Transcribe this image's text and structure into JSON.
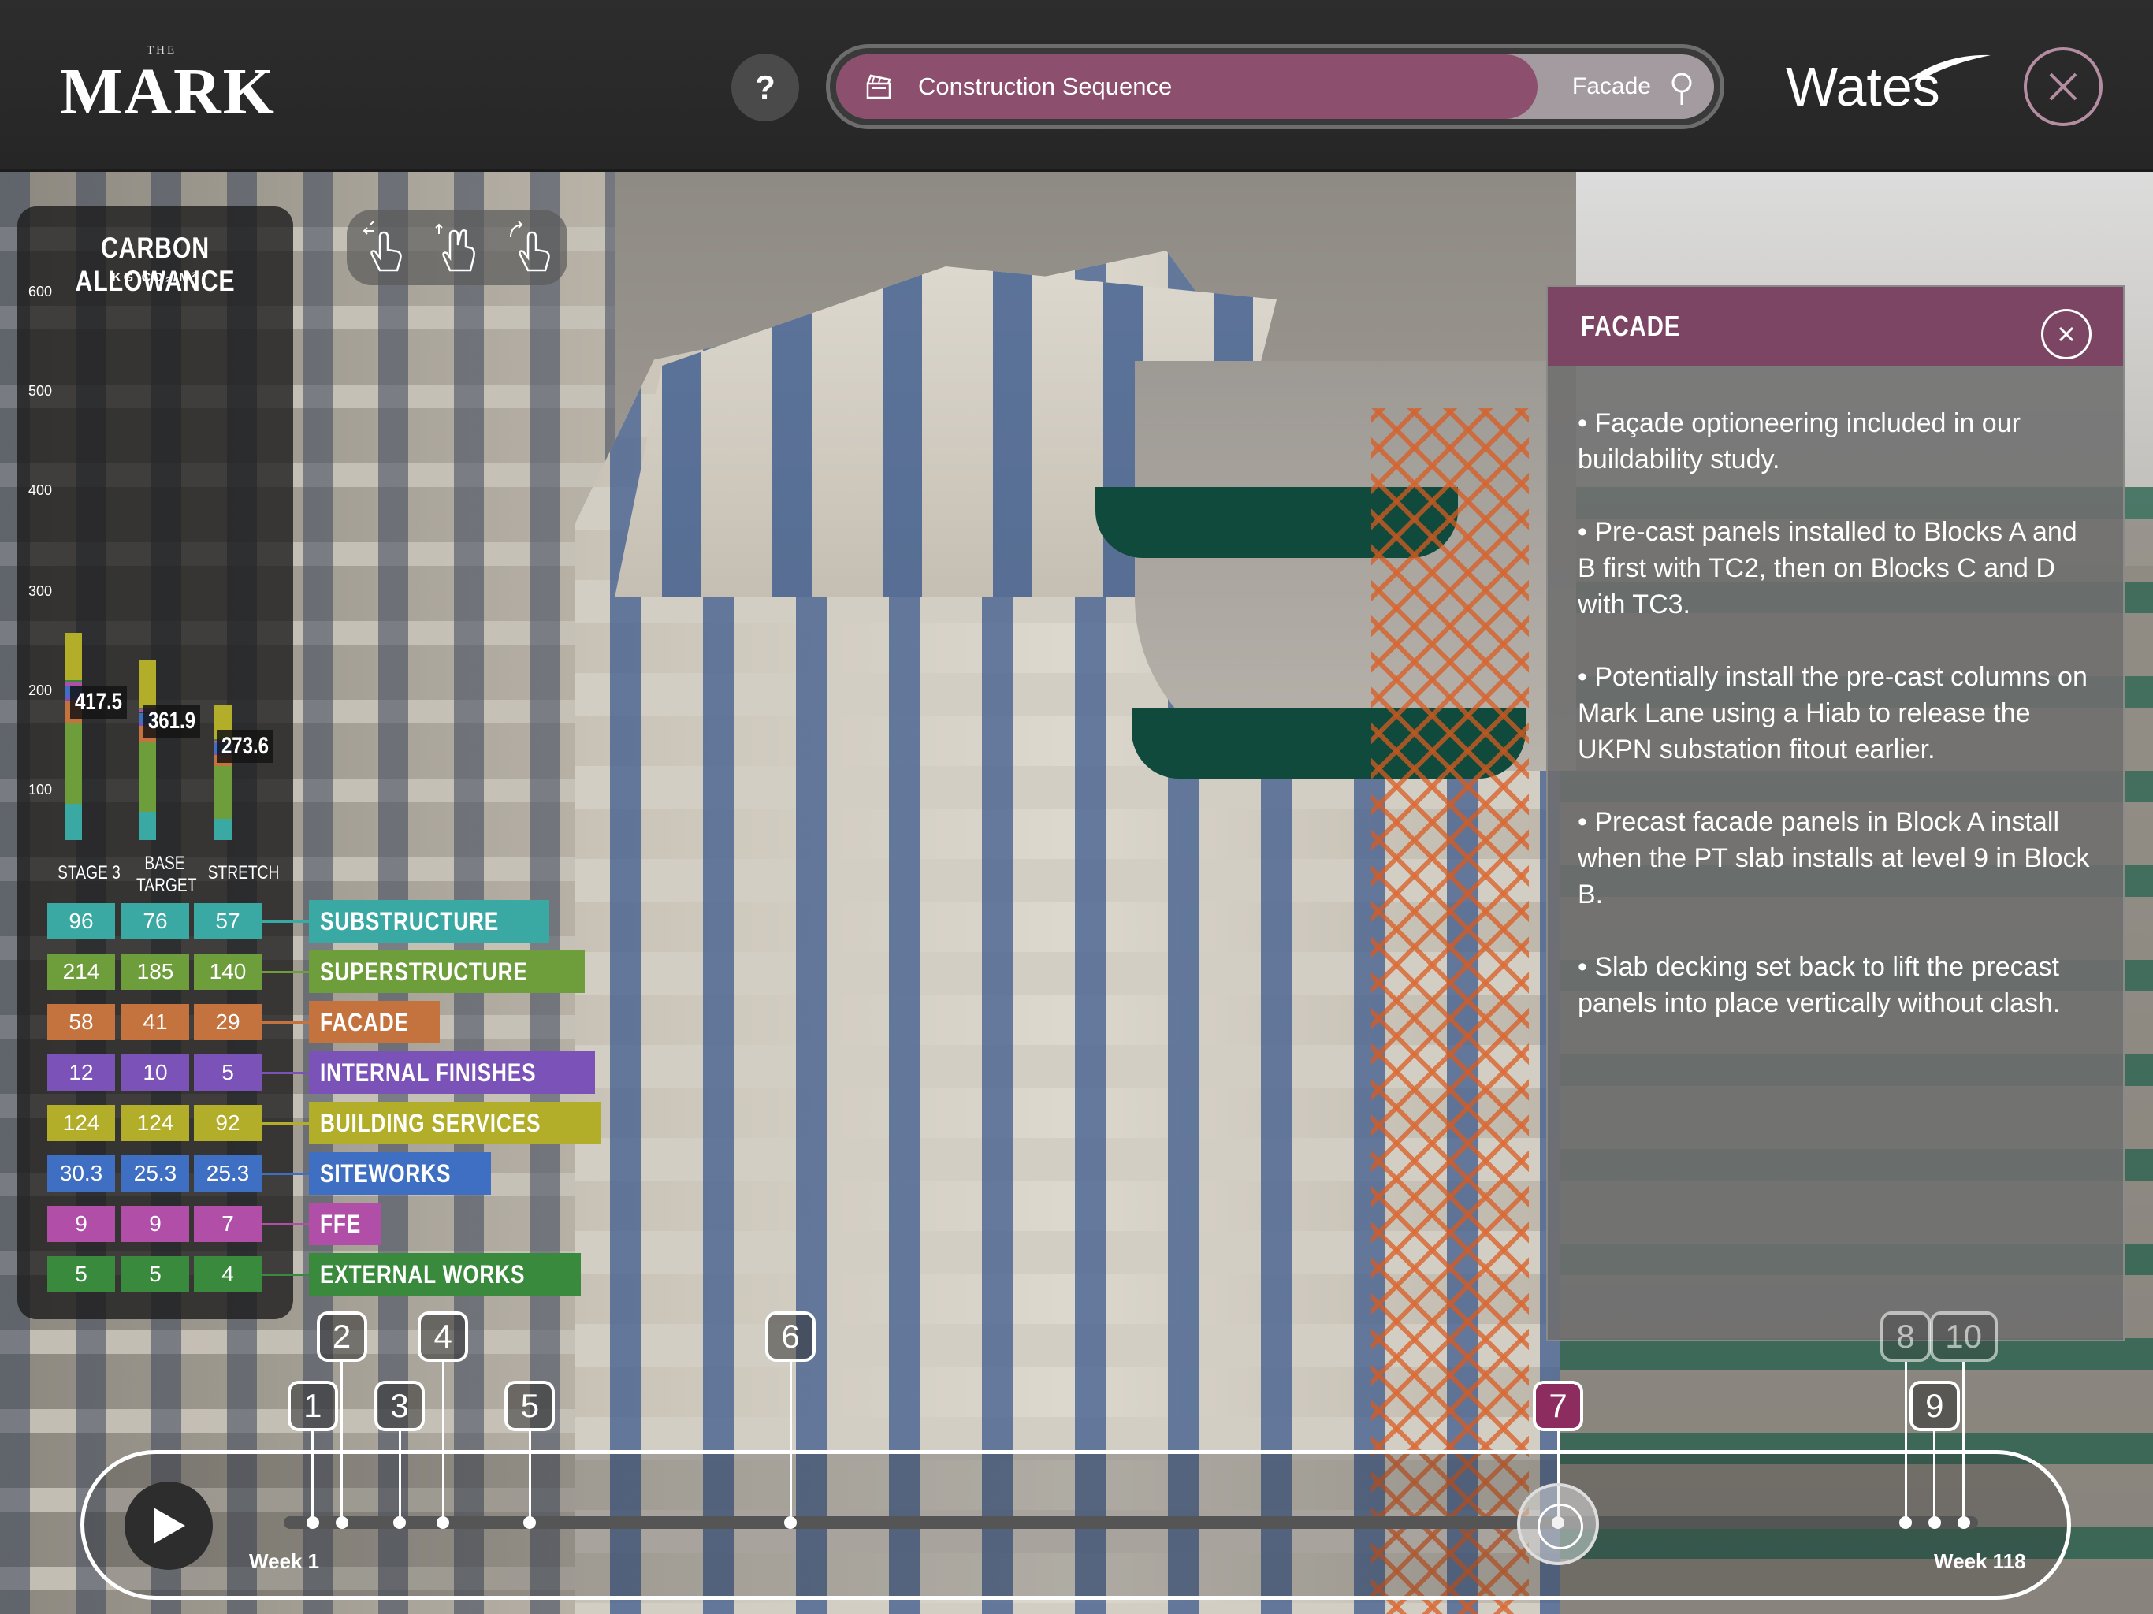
{
  "header": {
    "logo_small": "THE",
    "logo_main": "MARK",
    "help_label": "?",
    "search_label": "Construction Sequence",
    "search_value": "Facade",
    "brand": "Wates",
    "accent": "#8d4f6e"
  },
  "carbon": {
    "title": "CARBON ALLOWANCE",
    "unit": "KG CO₂/M²",
    "ticks": [
      "600",
      "500",
      "400",
      "300",
      "200",
      "100"
    ],
    "columns": [
      {
        "label": "STAGE 3",
        "total": "417.5"
      },
      {
        "label": "BASE TARGET",
        "total": "361.9"
      },
      {
        "label": "STRETCH",
        "total": "273.6"
      }
    ],
    "categories": [
      {
        "name": "SUBSTRUCTURE",
        "color": "#3aa9a4",
        "values": [
          "96",
          "76",
          "57"
        ]
      },
      {
        "name": "SUPERSTRUCTURE",
        "color": "#6d9e3b",
        "values": [
          "214",
          "185",
          "140"
        ]
      },
      {
        "name": "FACADE",
        "color": "#c4733e",
        "values": [
          "58",
          "41",
          "29"
        ]
      },
      {
        "name": "INTERNAL FINISHES",
        "color": "#7a52b8",
        "values": [
          "12",
          "10",
          "5"
        ]
      },
      {
        "name": "BUILDING SERVICES",
        "color": "#b2ae29",
        "values": [
          "124",
          "124",
          "92"
        ]
      },
      {
        "name": "SITEWORKS",
        "color": "#3f6fc2",
        "values": [
          "30.3",
          "25.3",
          "25.3"
        ]
      },
      {
        "name": "FFE",
        "color": "#b04ea8",
        "values": [
          "9",
          "9",
          "7"
        ]
      },
      {
        "name": "EXTERNAL WORKS",
        "color": "#3a8a3e",
        "values": [
          "5",
          "5",
          "4"
        ]
      }
    ]
  },
  "info": {
    "title": "FACADE",
    "bullets": [
      "• Façade optioneering included in our buildability study.",
      "• Pre-cast panels installed to Blocks A and B first with TC2, then on Blocks C and D with TC3.",
      "• Potentially install the pre-cast columns on Mark Lane using a Hiab to release the UKPN substation fitout earlier.",
      "• Precast facade panels in Block A install when the PT slab installs at level 9 in Block B.",
      "• Slab decking set back to lift the precast panels into place vertically without clash."
    ]
  },
  "timeline": {
    "start_label": "Week 1",
    "end_label": "Week 118",
    "current_week": 89,
    "milestones": [
      {
        "label": "1",
        "week": 3,
        "tier": "low"
      },
      {
        "label": "2",
        "week": 5,
        "tier": "high"
      },
      {
        "label": "3",
        "week": 9,
        "tier": "low"
      },
      {
        "label": "4",
        "week": 12,
        "tier": "high"
      },
      {
        "label": "5",
        "week": 18,
        "tier": "low"
      },
      {
        "label": "6",
        "week": 36,
        "tier": "high"
      },
      {
        "label": "7",
        "week": 89,
        "tier": "low",
        "active": true
      },
      {
        "label": "8",
        "week": 113,
        "tier": "high",
        "faded": true
      },
      {
        "label": "9",
        "week": 115,
        "tier": "low"
      },
      {
        "label": "10",
        "week": 117,
        "tier": "high",
        "faded": true
      }
    ]
  }
}
